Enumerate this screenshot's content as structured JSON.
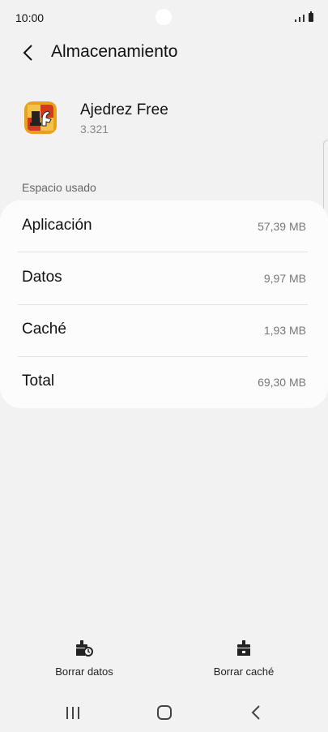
{
  "status_bar": {
    "time": "10:00"
  },
  "header": {
    "title": "Almacenamiento",
    "back_icon": "chevron-left-icon"
  },
  "app": {
    "name": "Ajedrez Free",
    "version": "3.321",
    "icon": "chess-app-icon"
  },
  "section": {
    "label": "Espacio usado"
  },
  "storage": [
    {
      "label": "Aplicación",
      "value": "57,39 MB"
    },
    {
      "label": "Datos",
      "value": "9,97 MB"
    },
    {
      "label": "Caché",
      "value": "1,93 MB"
    },
    {
      "label": "Total",
      "value": "69,30 MB"
    }
  ],
  "actions": {
    "clear_data": {
      "label": "Borrar datos",
      "icon": "clear-data-icon"
    },
    "clear_cache": {
      "label": "Borrar caché",
      "icon": "clear-cache-icon"
    }
  },
  "nav": {
    "recents_icon": "recents-icon",
    "home_icon": "home-icon",
    "back_icon": "back-icon"
  },
  "colors": {
    "background": "#f2f2f2",
    "card": "#fcfcfc",
    "icon_orange": "#e8a21a",
    "icon_red": "#d23a1e"
  }
}
